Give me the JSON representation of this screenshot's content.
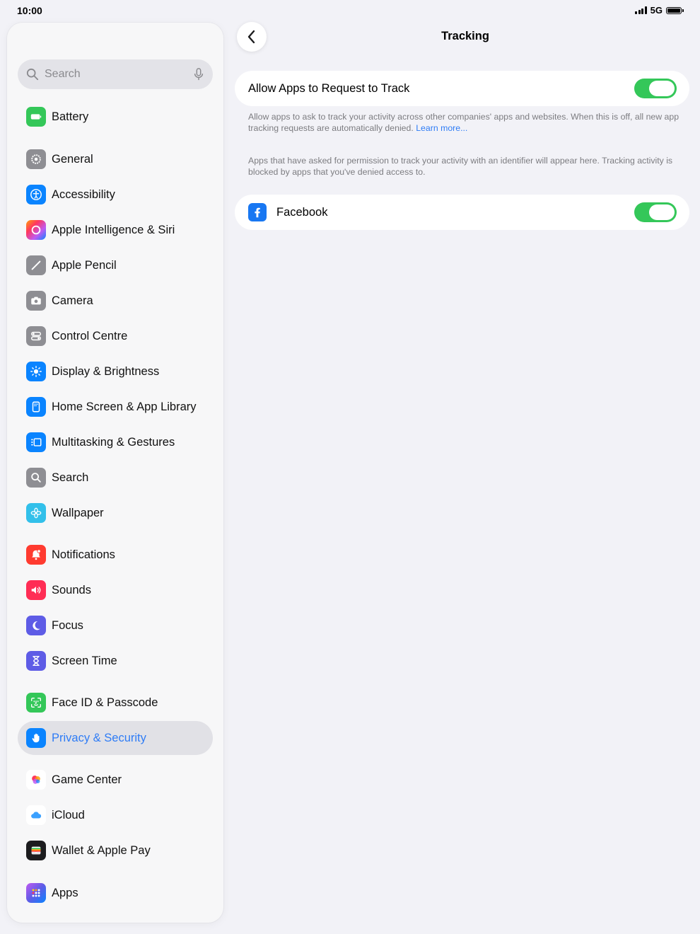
{
  "status_bar": {
    "time": "10:00",
    "network": "5G"
  },
  "search": {
    "placeholder": "Search"
  },
  "sidebar": {
    "items": [
      {
        "label": "Battery",
        "icon": "battery-icon",
        "color": "#34c759"
      },
      {
        "label": "General",
        "icon": "gear-icon",
        "color": "#8e8e93"
      },
      {
        "label": "Accessibility",
        "icon": "accessibility-icon",
        "color": "#0a84ff"
      },
      {
        "label": "Apple Intelligence & Siri",
        "icon": "apple-intelligence-icon",
        "color": "#ff6b9a"
      },
      {
        "label": "Apple Pencil",
        "icon": "pencil-icon",
        "color": "#8e8e93"
      },
      {
        "label": "Camera",
        "icon": "camera-icon",
        "color": "#8e8e93"
      },
      {
        "label": "Control Centre",
        "icon": "control-centre-icon",
        "color": "#8e8e93"
      },
      {
        "label": "Display & Brightness",
        "icon": "brightness-icon",
        "color": "#0a84ff"
      },
      {
        "label": "Home Screen & App Library",
        "icon": "home-screen-icon",
        "color": "#0a84ff"
      },
      {
        "label": "Multitasking & Gestures",
        "icon": "multitasking-icon",
        "color": "#0a84ff"
      },
      {
        "label": "Search",
        "icon": "search-icon",
        "color": "#8e8e93"
      },
      {
        "label": "Wallpaper",
        "icon": "wallpaper-icon",
        "color": "#32c0ea"
      },
      {
        "label": "Notifications",
        "icon": "bell-icon",
        "color": "#ff3b30"
      },
      {
        "label": "Sounds",
        "icon": "speaker-icon",
        "color": "#ff2d55"
      },
      {
        "label": "Focus",
        "icon": "moon-icon",
        "color": "#5e5ce6"
      },
      {
        "label": "Screen Time",
        "icon": "hourglass-icon",
        "color": "#5e5ce6"
      },
      {
        "label": "Face ID & Passcode",
        "icon": "face-id-icon",
        "color": "#34c759"
      },
      {
        "label": "Privacy & Security",
        "icon": "hand-icon",
        "color": "#0a84ff",
        "selected": true
      },
      {
        "label": "Game Center",
        "icon": "game-center-icon",
        "color": "#ffffff"
      },
      {
        "label": "iCloud",
        "icon": "cloud-icon",
        "color": "#ffffff"
      },
      {
        "label": "Wallet & Apple Pay",
        "icon": "wallet-icon",
        "color": "#1c1c1e"
      },
      {
        "label": "Apps",
        "icon": "apps-grid-icon",
        "color": "#5e5ce6"
      }
    ]
  },
  "main": {
    "title": "Tracking",
    "allow_row": {
      "label": "Allow Apps to Request to Track",
      "on": true
    },
    "footnote1": "Allow apps to ask to track your activity across other companies' apps and websites. When this is off, all new app tracking requests are automatically denied.",
    "learn_more": "Learn more...",
    "footnote2": "Apps that have asked for permission to track your activity with an identifier will appear here. Tracking activity is blocked by apps that you've denied access to.",
    "apps": [
      {
        "label": "Facebook",
        "icon": "facebook-icon",
        "on": true
      }
    ]
  },
  "colors": {
    "accent": "#2e7cf6",
    "toggle_on": "#34c759",
    "background": "#f2f2f7"
  }
}
